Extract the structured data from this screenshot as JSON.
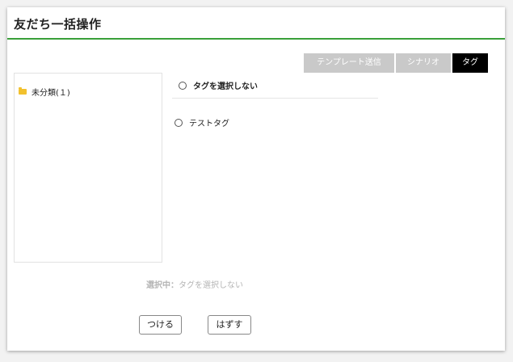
{
  "dialog": {
    "title": "友だち一括操作"
  },
  "tabs": [
    {
      "label": "テンプレート送信",
      "active": false
    },
    {
      "label": "シナリオ",
      "active": false
    },
    {
      "label": "タグ",
      "active": true
    }
  ],
  "folders": [
    {
      "label": "未分類(１)",
      "icon": "folder-icon"
    }
  ],
  "tag_options": {
    "none_label": "タグを選択しない",
    "items": [
      "テストタグ"
    ]
  },
  "selection": {
    "label": "選択中：",
    "value": "タグを選択しない"
  },
  "buttons": {
    "attach": "つける",
    "detach": "はずす"
  },
  "colors": {
    "title_rule": "#3aa03a",
    "tab_active": "#000000",
    "tab_inactive": "#c9c9c9",
    "folder_icon": "#f2c12e"
  }
}
